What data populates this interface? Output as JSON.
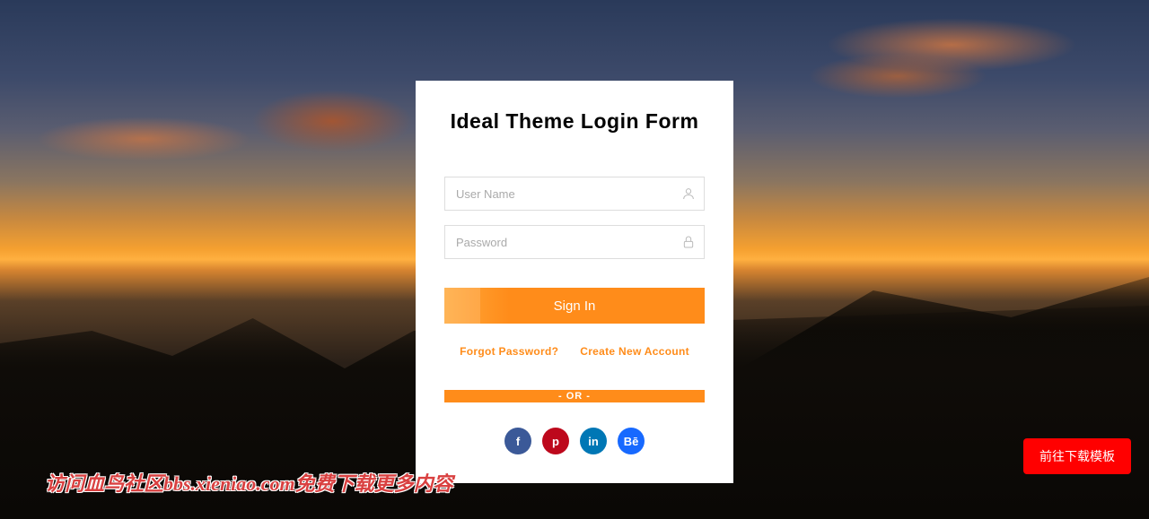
{
  "form": {
    "title": "Ideal Theme Login Form",
    "username_placeholder": "User Name",
    "password_placeholder": "Password",
    "submit_label": "Sign In",
    "forgot_label": "Forgot Password?",
    "create_label": "Create New Account",
    "divider_label": "- OR -"
  },
  "social": {
    "facebook": "f",
    "pinterest": "p",
    "linkedin": "in",
    "behance": "Bē"
  },
  "download_button": "前往下载模板",
  "watermark": "访问血鸟社区bbs.xieniao.com免费下载更多内容"
}
